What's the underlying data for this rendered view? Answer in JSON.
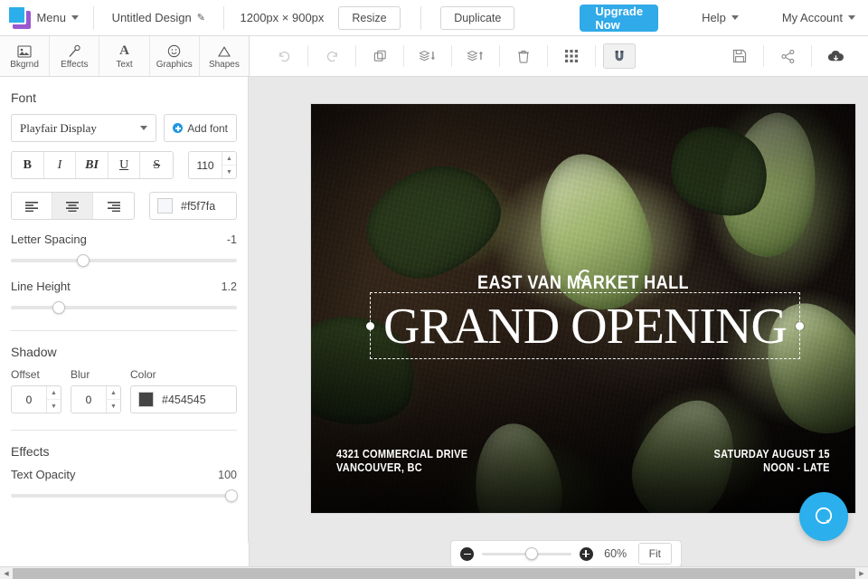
{
  "app": {
    "logo_icon": "stacked-squares-logo",
    "menu_label": "Menu",
    "design_title": "Untitled Design",
    "edit_icon": "pencil-icon",
    "dimensions": "1200px × 900px",
    "resize_label": "Resize",
    "duplicate_label": "Duplicate",
    "upgrade_label": "Upgrade Now",
    "help_label": "Help",
    "account_label": "My Account",
    "accent_color": "#30aae8"
  },
  "tooltabs": [
    {
      "label": "Bkgrnd",
      "icon": "image-icon",
      "glyph": "⛰"
    },
    {
      "label": "Effects",
      "icon": "wand-icon",
      "glyph": "⚒"
    },
    {
      "label": "Text",
      "icon": "text-a-icon",
      "glyph": "A"
    },
    {
      "label": "Graphics",
      "icon": "smiley-icon",
      "glyph": "☺"
    },
    {
      "label": "Shapes",
      "icon": "triangle-icon",
      "glyph": "△"
    }
  ],
  "canvas_toolbar": [
    {
      "name": "undo-button",
      "icon": "undo-icon",
      "state": "disabled"
    },
    {
      "name": "redo-button",
      "icon": "redo-icon",
      "state": "disabled"
    },
    {
      "name": "duplicate-button",
      "icon": "copy-icon",
      "state": "normal"
    },
    {
      "name": "send-backward-button",
      "icon": "layers-down-icon",
      "state": "normal"
    },
    {
      "name": "bring-forward-button",
      "icon": "layers-up-icon",
      "state": "normal"
    },
    {
      "name": "delete-button",
      "icon": "trash-icon",
      "state": "normal"
    },
    {
      "name": "grid-button",
      "icon": "grid-icon",
      "state": "normal"
    },
    {
      "name": "snap-magnet-button",
      "icon": "magnet-icon",
      "state": "active"
    },
    {
      "name": "save-button",
      "icon": "floppy-save-icon",
      "state": "normal"
    },
    {
      "name": "share-button",
      "icon": "share-icon",
      "state": "normal"
    },
    {
      "name": "download-button",
      "icon": "cloud-download-icon",
      "state": "normal"
    }
  ],
  "panel": {
    "font_section_title": "Font",
    "font_family": "Playfair Display",
    "add_font_label": "Add font",
    "styles": [
      {
        "label": "B",
        "name": "bold-button",
        "active": false
      },
      {
        "label": "I",
        "name": "italic-button",
        "active": false
      },
      {
        "label": "BI",
        "name": "bold-italic-button",
        "active": false
      },
      {
        "label": "U",
        "name": "underline-button",
        "active": false
      },
      {
        "label": "S",
        "name": "strikethrough-button",
        "active": false
      }
    ],
    "font_size": "110",
    "align": [
      {
        "name": "align-left-button",
        "icon": "align-left-icon",
        "active": false
      },
      {
        "name": "align-center-button",
        "icon": "align-center-icon",
        "active": true
      },
      {
        "name": "align-right-button",
        "icon": "align-right-icon",
        "active": false
      }
    ],
    "text_color": "#f5f7fa",
    "letter_spacing_label": "Letter Spacing",
    "letter_spacing_value": "-1",
    "line_height_label": "Line Height",
    "line_height_value": "1.2",
    "shadow_section_title": "Shadow",
    "shadow_offset_label": "Offset",
    "shadow_offset_value": "0",
    "shadow_blur_label": "Blur",
    "shadow_blur_value": "0",
    "shadow_color_label": "Color",
    "shadow_color": "#454545",
    "effects_section_title": "Effects",
    "text_opacity_label": "Text Opacity",
    "text_opacity_value": "100"
  },
  "artboard": {
    "subtitle": "EAST VAN MARKET HALL",
    "headline": "GRAND OPENING",
    "address_line1": "4321 COMMERCIAL DRIVE",
    "address_line2": "VANCOUVER, BC",
    "date_line1": "SATURDAY AUGUST 15",
    "date_line2": "NOON - LATE"
  },
  "zoombar": {
    "zoom_out_icon": "minus-circle-icon",
    "zoom_in_icon": "plus-circle-icon",
    "zoom_value": "60%",
    "fit_label": "Fit"
  },
  "chat": {
    "icon": "chat-bubble-icon"
  }
}
